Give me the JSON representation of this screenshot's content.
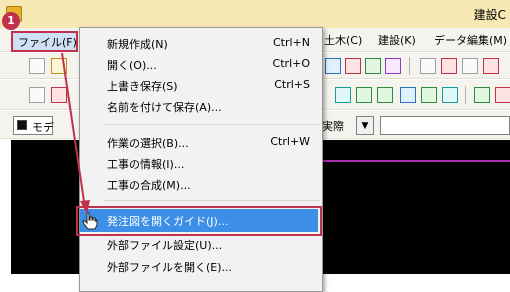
{
  "window": {
    "title": "建設C"
  },
  "step_badge": "1",
  "menubar": {
    "file": "ファイル(F)",
    "doboku": "土木(C)",
    "kensetsu": "建設(K)",
    "data_edit": "データ編集(M)"
  },
  "toolbar": {
    "mode_label": "モデ",
    "jissai_label": "実際",
    "jissai_dropdown": "▼"
  },
  "file_menu": {
    "items": [
      {
        "label": "新規作成(N)",
        "shortcut": "Ctrl+N"
      },
      {
        "label": "開く(O)...",
        "shortcut": "Ctrl+O"
      },
      {
        "label": "上書き保存(S)",
        "shortcut": "Ctrl+S"
      },
      {
        "label": "名前を付けて保存(A)...",
        "shortcut": ""
      },
      {
        "label": "作業の選択(B)...",
        "shortcut": "Ctrl+W"
      },
      {
        "label": "工事の情報(I)...",
        "shortcut": ""
      },
      {
        "label": "工事の合成(M)...",
        "shortcut": ""
      },
      {
        "label": "発注図を開くガイド(J)...",
        "shortcut": ""
      },
      {
        "label": "外部ファイル設定(U)...",
        "shortcut": ""
      },
      {
        "label": "外部ファイルを開く(E)...",
        "shortcut": ""
      }
    ]
  },
  "colors": {
    "highlight_border": "#c0324b",
    "selected_item": "#3d8ee6",
    "titlebar": "#f6e9b4",
    "canvas": "#000000",
    "canvas_line": "#a92fa9"
  },
  "icons": {
    "hand_cursor": "hand-pointer-icon",
    "badge": "step-number-badge"
  }
}
